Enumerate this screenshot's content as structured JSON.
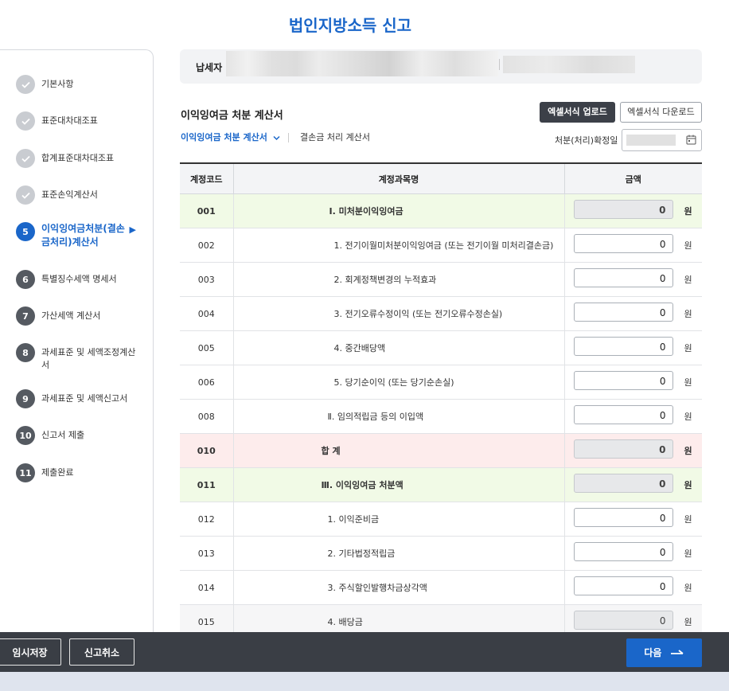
{
  "page": {
    "title": "법인지방소득 신고"
  },
  "steps": [
    {
      "num": "",
      "label": "기본사항",
      "state": "done"
    },
    {
      "num": "",
      "label": "표준대차대조표",
      "state": "done"
    },
    {
      "num": "",
      "label": "합계표준대차대조표",
      "state": "done"
    },
    {
      "num": "",
      "label": "표준손익계산서",
      "state": "done"
    },
    {
      "num": "5",
      "label": "이익잉여금처분(결손금처리)계산서",
      "state": "current"
    },
    {
      "num": "6",
      "label": "특별징수세액 명세서",
      "state": "todo"
    },
    {
      "num": "7",
      "label": "가산세액 계산서",
      "state": "todo"
    },
    {
      "num": "8",
      "label": "과세표준 및 세액조정계산서",
      "state": "todo"
    },
    {
      "num": "9",
      "label": "과세표준 및 세액신고서",
      "state": "todo"
    },
    {
      "num": "10",
      "label": "신고서 제출",
      "state": "todo"
    },
    {
      "num": "11",
      "label": "제출완료",
      "state": "todo"
    }
  ],
  "taxpayer": {
    "label": "납세자"
  },
  "section": {
    "title": "이익잉여금 처분 계산서",
    "upload_label": "엑셀서식 업로드",
    "download_label": "엑셀서식 다운로드",
    "tab_active": "이익잉여금 처분 계산서",
    "tab_other": "결손금 처리 계산서",
    "date_label": "처분(처리)확정일 :"
  },
  "table": {
    "headers": [
      "계정코드",
      "계정과목명",
      "금액"
    ],
    "unit": "원",
    "rows": [
      {
        "code": "001",
        "name": "Ⅰ. 미처분이익잉여금",
        "amount": "0",
        "style": "green",
        "readonly": true
      },
      {
        "code": "002",
        "name": "1. 전기이월미처분이익잉여금 (또는 전기이월 미처리결손금)",
        "amount": "0",
        "style": "",
        "readonly": false
      },
      {
        "code": "003",
        "name": "2. 회계정책변경의 누적효과",
        "amount": "0",
        "style": "",
        "readonly": false
      },
      {
        "code": "004",
        "name": "3. 전기오류수정이익 (또는 전기오류수정손실)",
        "amount": "0",
        "style": "",
        "readonly": false
      },
      {
        "code": "005",
        "name": "4. 중간배당액",
        "amount": "0",
        "style": "",
        "readonly": false
      },
      {
        "code": "006",
        "name": "5. 당기순이익 (또는 당기순손실)",
        "amount": "0",
        "style": "",
        "readonly": false
      },
      {
        "code": "008",
        "name": "Ⅱ. 임의적립금 등의 이입액",
        "amount": "0",
        "style": "",
        "readonly": false
      },
      {
        "code": "010",
        "name": "합 계",
        "amount": "0",
        "style": "pink",
        "readonly": true
      },
      {
        "code": "011",
        "name": "Ⅲ. 이익잉여금 처분액",
        "amount": "0",
        "style": "green",
        "readonly": true
      },
      {
        "code": "012",
        "name": "1. 이익준비금",
        "amount": "0",
        "style": "",
        "readonly": false
      },
      {
        "code": "013",
        "name": "2. 기타법정적립금",
        "amount": "0",
        "style": "",
        "readonly": false
      },
      {
        "code": "014",
        "name": "3. 주식할인발행차금상각액",
        "amount": "0",
        "style": "",
        "readonly": false
      },
      {
        "code": "015",
        "name": "4. 배당금",
        "amount": "0",
        "style": "gray",
        "readonly": true
      }
    ]
  },
  "bottom": {
    "save_label": "임시저장",
    "cancel_label": "신고취소",
    "next_label": "다음"
  }
}
